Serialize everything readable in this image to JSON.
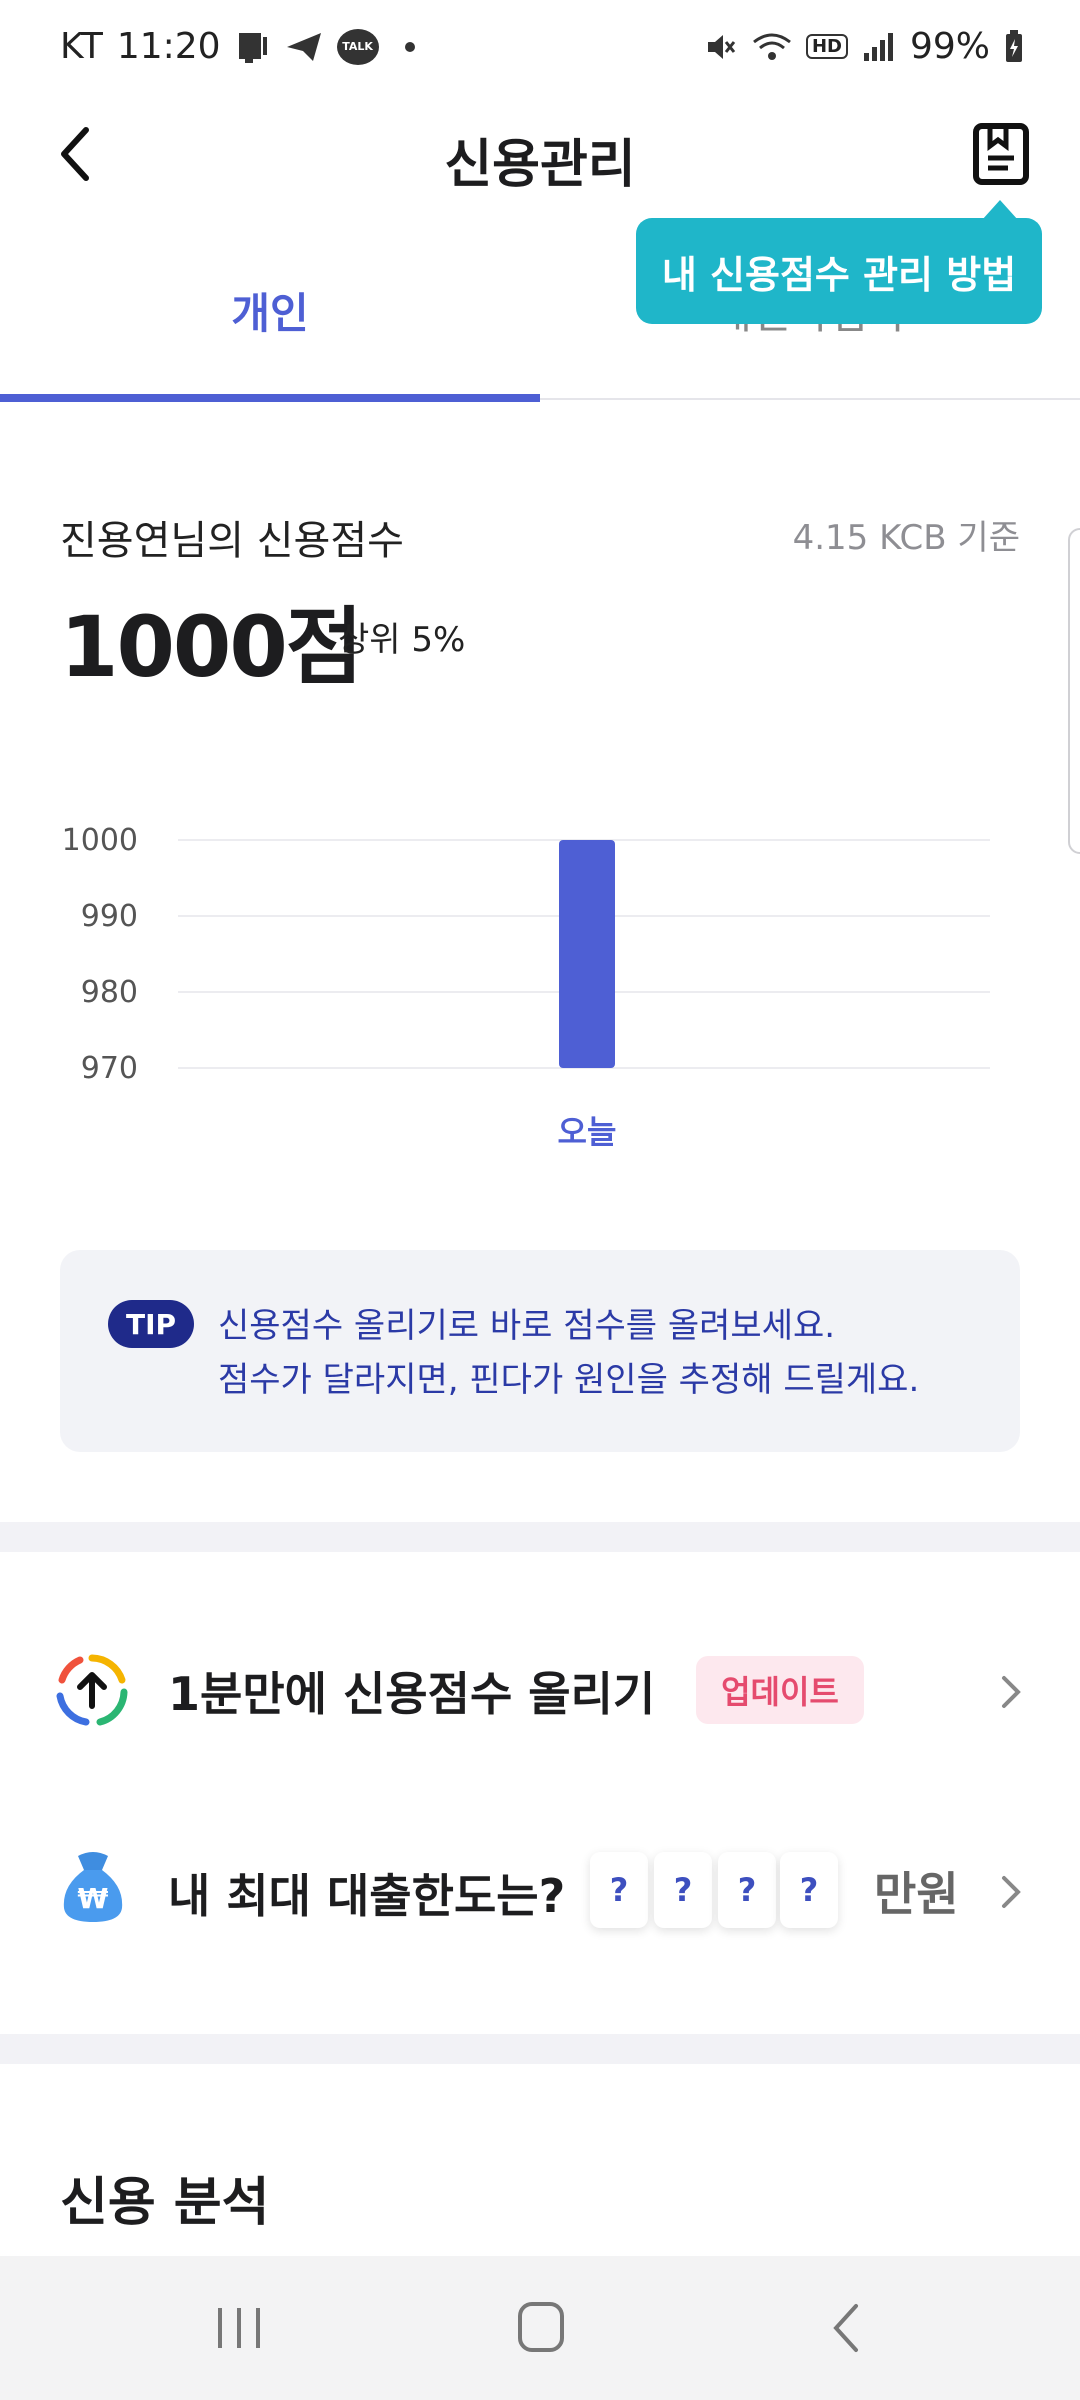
{
  "status_bar": {
    "carrier": "KT",
    "time": "11:20",
    "talk_badge": "TALK",
    "hd_badge": "HD",
    "battery": "99%"
  },
  "header": {
    "title": "신용관리",
    "tooltip": "내 신용점수 관리 방법"
  },
  "tabs": [
    {
      "label": "개인"
    },
    {
      "label": "개인사업자"
    }
  ],
  "score": {
    "label": "진용연님의 신용점수",
    "basis": "4.15 KCB 기준",
    "value": "1000점",
    "rank": "상위 5%"
  },
  "chart_data": {
    "type": "bar",
    "categories": [
      "오늘"
    ],
    "values": [
      1000
    ],
    "ylim": [
      970,
      1000
    ],
    "yticks": [
      1000,
      990,
      980,
      970
    ],
    "grid": true,
    "bar_color": "#4e5fd4"
  },
  "tip": {
    "badge": "TIP",
    "line1": "신용점수 올리기로 바로 점수를 올려보세요.",
    "line2": "점수가 달라지면, 핀다가 원인을 추정해 드릴게요."
  },
  "menu": {
    "boost": {
      "label": "1분만에 신용점수 올리기",
      "badge": "업데이트",
      "icon": "arrow-up-circle-icon"
    },
    "loan": {
      "label": "내 최대 대출한도는?",
      "digits": [
        "?",
        "?",
        "?",
        "?"
      ],
      "unit": "만원",
      "icon": "money-bag-icon"
    }
  },
  "section": {
    "title": "신용 분석"
  },
  "colors": {
    "accent": "#4e5fd4",
    "tooltip": "#1fb6c9",
    "tip_text": "#2b3aa6",
    "badge_pink": "#e54b6e"
  }
}
